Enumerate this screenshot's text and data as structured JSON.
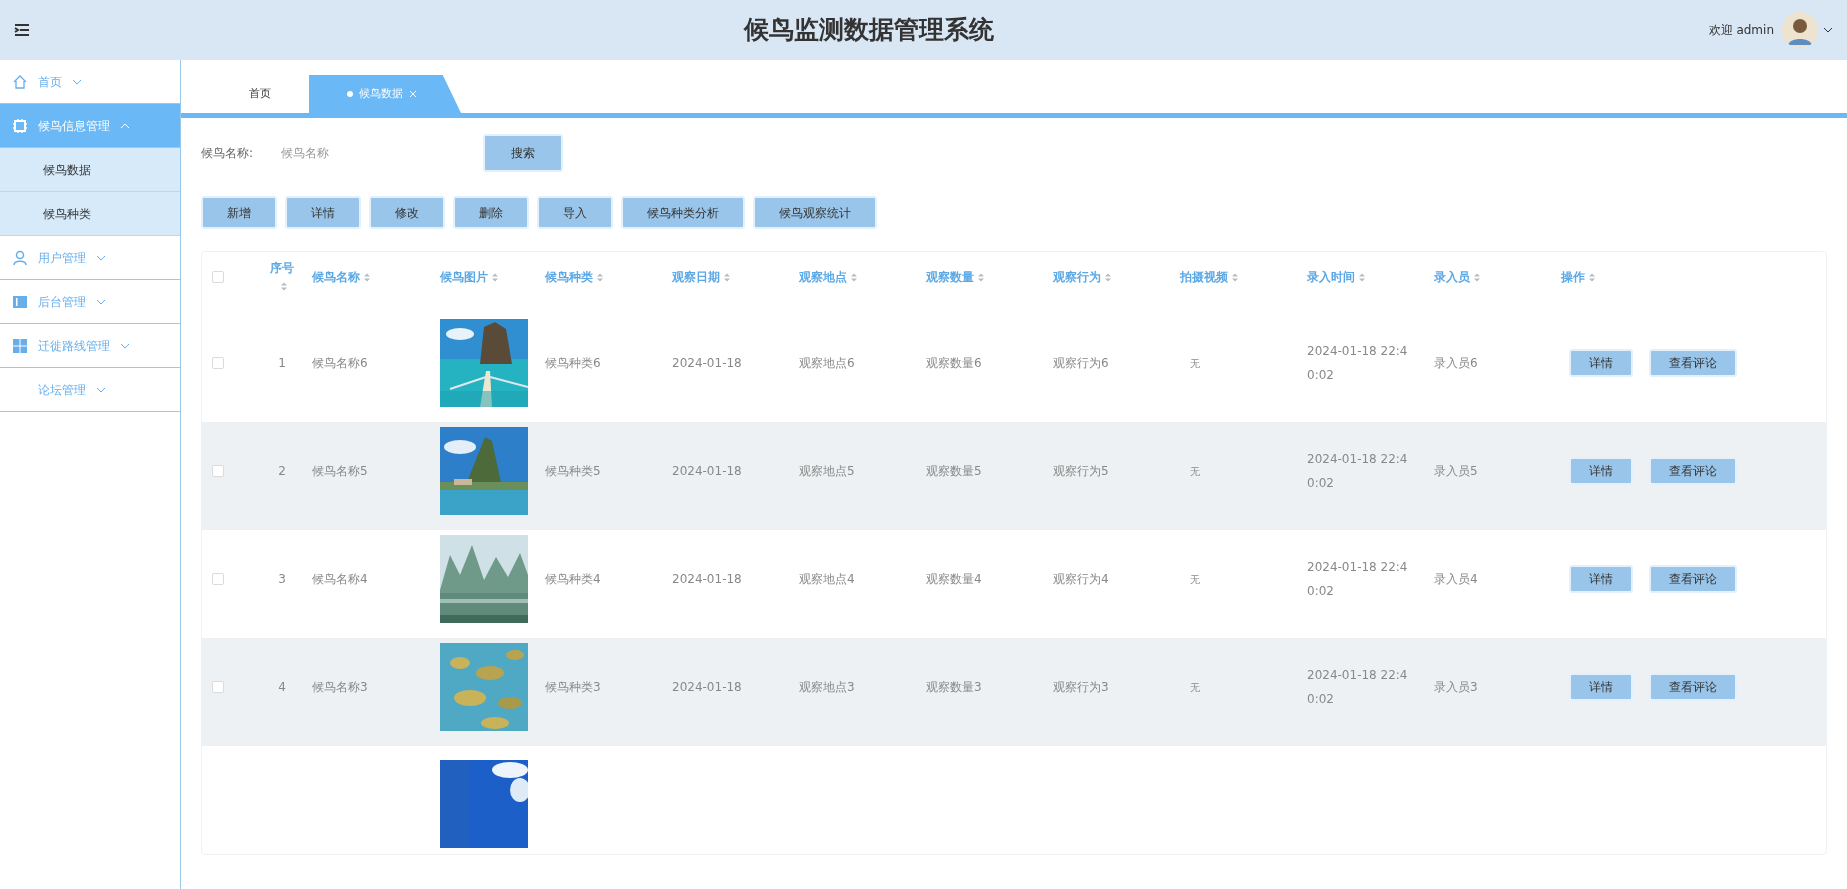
{
  "header": {
    "title": "候鸟监测数据管理系统",
    "welcome": "欢迎 admin"
  },
  "sidebar": {
    "items": [
      {
        "label": "首页",
        "selected": false,
        "expanded": false
      },
      {
        "label": "候鸟信息管理",
        "selected": true,
        "expanded": true,
        "children": [
          {
            "label": "候鸟数据"
          },
          {
            "label": "候鸟种类"
          }
        ]
      },
      {
        "label": "用户管理",
        "selected": false,
        "expanded": false
      },
      {
        "label": "后台管理",
        "selected": false,
        "expanded": false
      },
      {
        "label": "迁徙路线管理",
        "selected": false,
        "expanded": false
      },
      {
        "label": "论坛管理",
        "selected": false,
        "expanded": false
      }
    ]
  },
  "tabs": [
    {
      "label": "首页",
      "selected": false,
      "closable": false
    },
    {
      "label": "候鸟数据",
      "selected": true,
      "closable": true
    }
  ],
  "search": {
    "label": "候鸟名称:",
    "placeholder": "候鸟名称",
    "button": "搜索"
  },
  "actions": [
    "新增",
    "详情",
    "修改",
    "删除",
    "导入",
    "候鸟种类分析",
    "候鸟观察统计"
  ],
  "table": {
    "select_all": {
      "checked": false
    },
    "columns": [
      {
        "label": "序号"
      },
      {
        "label": "候鸟名称"
      },
      {
        "label": "候鸟图片"
      },
      {
        "label": "候鸟种类"
      },
      {
        "label": "观察日期"
      },
      {
        "label": "观察地点"
      },
      {
        "label": "观察数量"
      },
      {
        "label": "观察行为"
      },
      {
        "label": "拍摄视频"
      },
      {
        "label": "录入时间"
      },
      {
        "label": "录入员"
      },
      {
        "label": "操作"
      }
    ],
    "rows": [
      {
        "checked": false,
        "index": "1",
        "name": "候鸟名称6",
        "species": "候鸟种类6",
        "date": "2024-01-18",
        "place": "观察地点6",
        "count": "观察数量6",
        "behavior": "观察行为6",
        "video": "无",
        "created": "2024-01-18 22:40:02",
        "recorder": "录入员6",
        "buttons": [
          "详情",
          "查看评论"
        ]
      },
      {
        "checked": false,
        "index": "2",
        "name": "候鸟名称5",
        "species": "候鸟种类5",
        "date": "2024-01-18",
        "place": "观察地点5",
        "count": "观察数量5",
        "behavior": "观察行为5",
        "video": "无",
        "created": "2024-01-18 22:40:02",
        "recorder": "录入员5",
        "buttons": [
          "详情",
          "查看评论"
        ]
      },
      {
        "checked": false,
        "index": "3",
        "name": "候鸟名称4",
        "species": "候鸟种类4",
        "date": "2024-01-18",
        "place": "观察地点4",
        "count": "观察数量4",
        "behavior": "观察行为4",
        "video": "无",
        "created": "2024-01-18 22:40:02",
        "recorder": "录入员4",
        "buttons": [
          "详情",
          "查看评论"
        ]
      },
      {
        "checked": false,
        "index": "4",
        "name": "候鸟名称3",
        "species": "候鸟种类3",
        "date": "2024-01-18",
        "place": "观察地点3",
        "count": "观察数量3",
        "behavior": "观察行为3",
        "video": "无",
        "created": "2024-01-18 22:40:02",
        "recorder": "录入员3",
        "buttons": [
          "详情",
          "查看评论"
        ]
      }
    ]
  }
}
